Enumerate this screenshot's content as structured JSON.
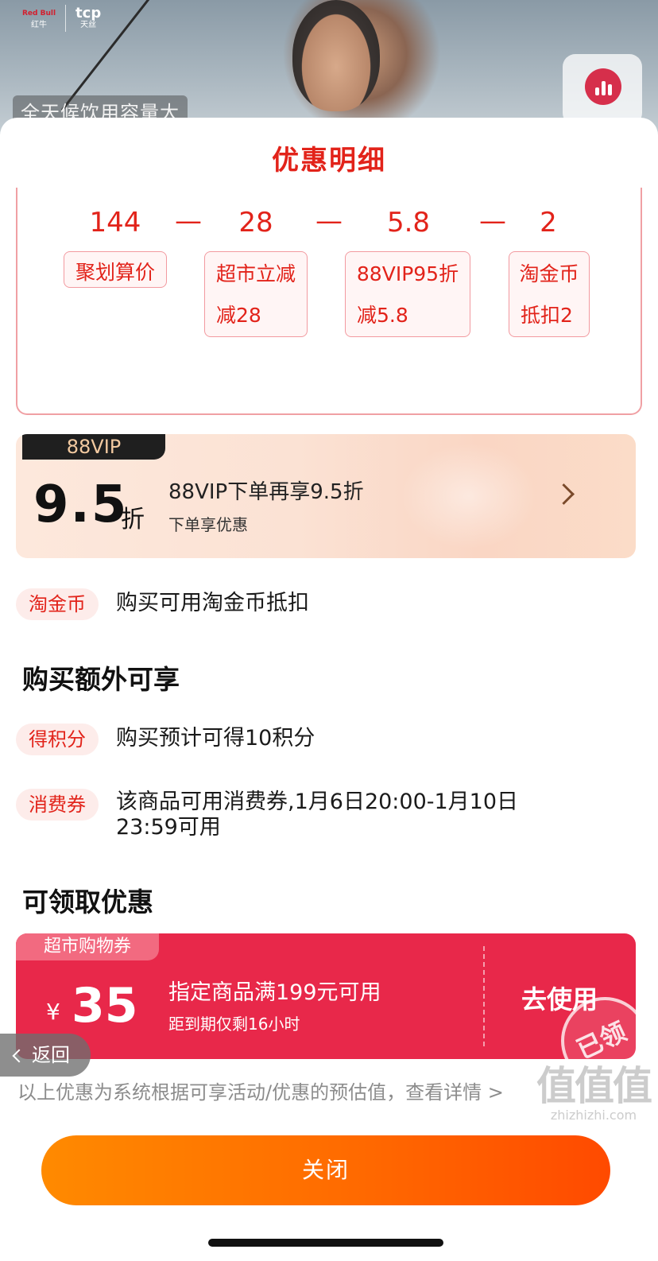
{
  "banner": {
    "brand_1": "红牛",
    "brand_1_mark": "Red Bull",
    "brand_2": "天丝",
    "brand_2_mark": "tcp",
    "caption": "全天候饮用容量大"
  },
  "sheet": {
    "title": "优惠明细"
  },
  "calc": {
    "values": [
      "144",
      "28",
      "5.8",
      "2"
    ],
    "operator": "—",
    "chips": [
      {
        "title": "聚划算价",
        "sub": ""
      },
      {
        "title": "超市立减",
        "sub": "减28"
      },
      {
        "title": "88VIP95折",
        "sub": "减5.8"
      },
      {
        "title": "淘金币",
        "sub": "抵扣2"
      }
    ]
  },
  "vip": {
    "tag": "88VIP",
    "discount": "9.5",
    "unit": "折",
    "title": "88VIP下单再享9.5折",
    "subtitle": "下单享优惠"
  },
  "taojinbi": {
    "pill": "淘金币",
    "text": "购买可用淘金币抵扣"
  },
  "extra": {
    "section_title": "购买额外可享",
    "items": [
      {
        "pill": "得积分",
        "text": "购买预计可得10积分"
      },
      {
        "pill": "消费券",
        "text": "该商品可用消费券,1月6日20:00-1月10日",
        "text_line2": "23:59可用"
      }
    ]
  },
  "claimable": {
    "section_title": "可领取优惠",
    "coupon": {
      "tag": "超市购物券",
      "currency": "¥",
      "amount": "35",
      "condition": "指定商品满199元可用",
      "expire": "距到期仅剩16小时",
      "action": "去使用",
      "stamp": "已领"
    }
  },
  "back": {
    "label": "返回"
  },
  "note": "以上优惠为系统根据可享活动/优惠的预估值，查看详情 >",
  "close_button": "关闭",
  "watermark": {
    "big": "值值值",
    "small": "zhizhizhi.com"
  },
  "colors": {
    "accent_red": "#e2231a",
    "coupon_red": "#e8284a",
    "close_orange": "#ff6a00"
  }
}
